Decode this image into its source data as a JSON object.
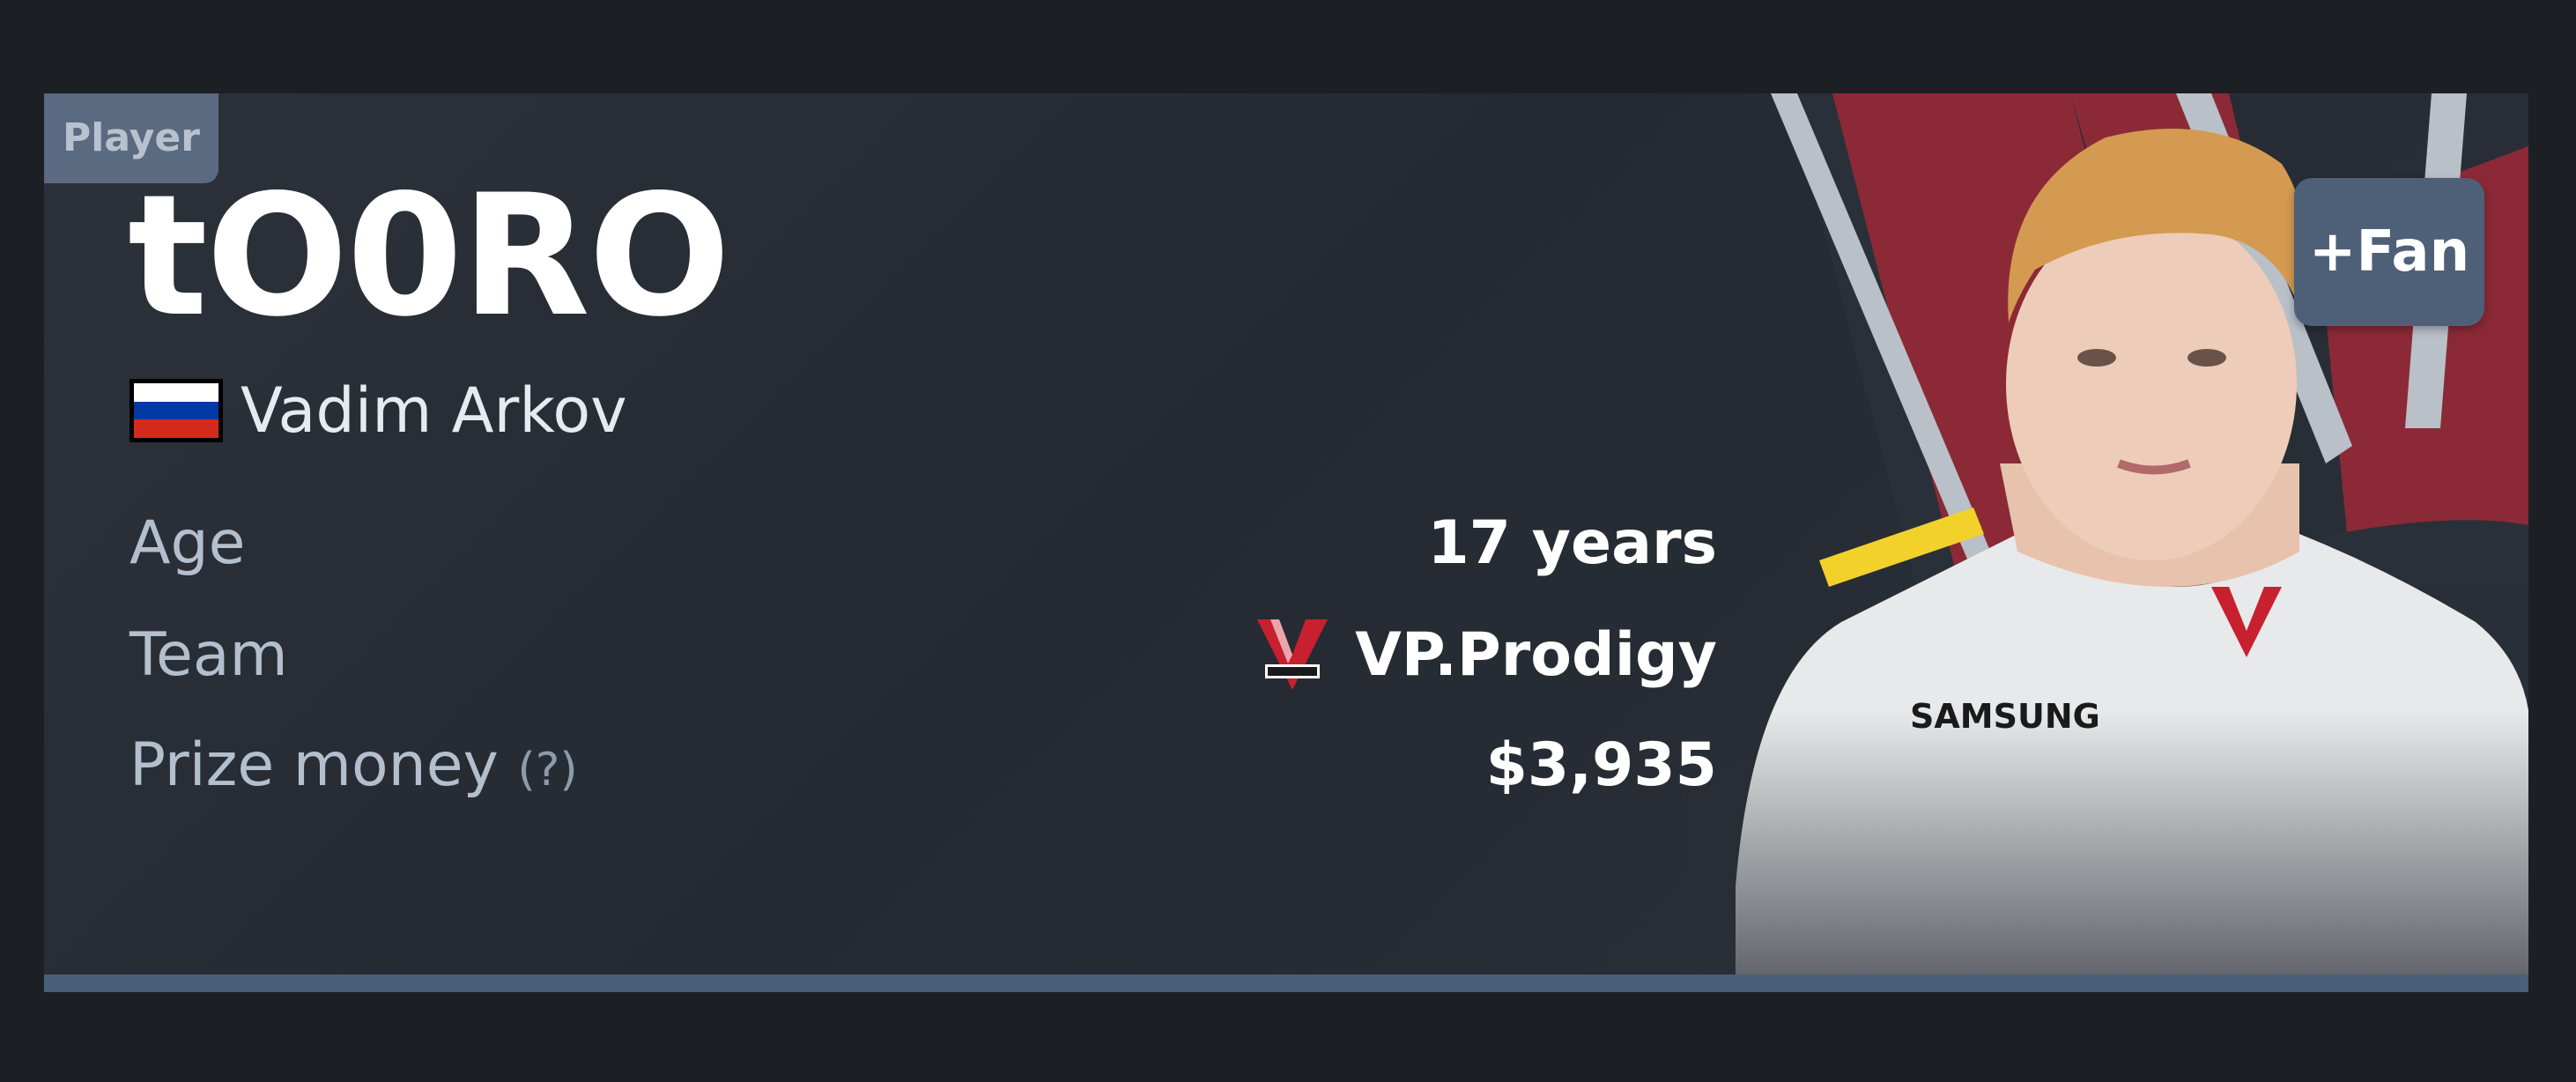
{
  "player_tag": "Player",
  "nickname": "tO0RO",
  "real_name": "Vadim Arkov",
  "fan_button": "+Fan",
  "stats": {
    "age_label": "Age",
    "age_value": "17 years",
    "team_label": "Team",
    "team_value": "VP.Prodigy",
    "prize_label": "Prize money",
    "prize_help": "(?)",
    "prize_value": "$3,935"
  },
  "colors": {
    "background": "#1c1f24",
    "card": "#2a2f37",
    "accent_bar": "#4a5f78",
    "fan_button": "#4e6077",
    "team_red": "#c8202f"
  },
  "icons": {
    "flag": "russia-flag-icon",
    "team_logo": "vp-prodigy-logo-icon"
  }
}
